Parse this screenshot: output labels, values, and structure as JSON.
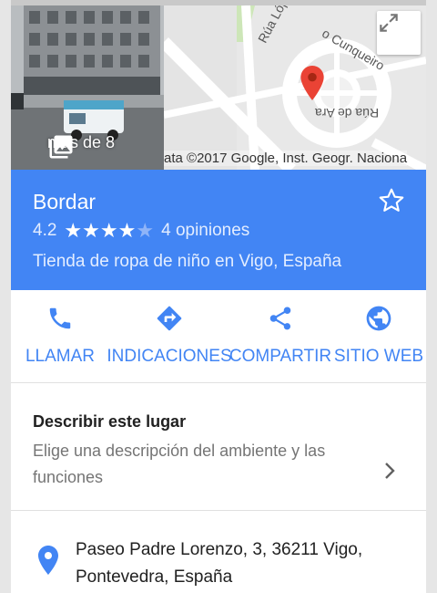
{
  "hero": {
    "photo_count_label": "más de 8",
    "photo_icon": "photo-library-icon",
    "map_attribution": "ata ©2017 Google, Inst. Geogr. Naciona",
    "map_street_1": "Rúa López Mora",
    "map_street_2": "o Cunqueiro",
    "map_street_3": "Rúa de Ara",
    "expand_icon": "fullscreen-icon",
    "pin_color": "#ea4335"
  },
  "place": {
    "name": "Bordar",
    "rating": "4.2",
    "stars": 4.2,
    "reviews": "4 opiniones",
    "category": "Tienda de ropa de niño en Vigo, España",
    "save_icon": "star-outline-icon",
    "header_color": "#4285f4"
  },
  "actions": [
    {
      "label": "LLAMAR",
      "icon": "phone-icon"
    },
    {
      "label": "INDICACIONES",
      "icon": "directions-icon"
    },
    {
      "label": "COMPARTIR",
      "icon": "share-icon"
    },
    {
      "label": "SITIO WEB",
      "icon": "globe-icon"
    }
  ],
  "describe": {
    "title": "Describir este lugar",
    "text": "Elige una descripción del ambiente y las funciones",
    "icon": "chevron-right-icon"
  },
  "address": {
    "text": "Paseo Padre Lorenzo, 3, 36211 Vigo, Pontevedra, España",
    "icon": "location-pin-icon"
  }
}
